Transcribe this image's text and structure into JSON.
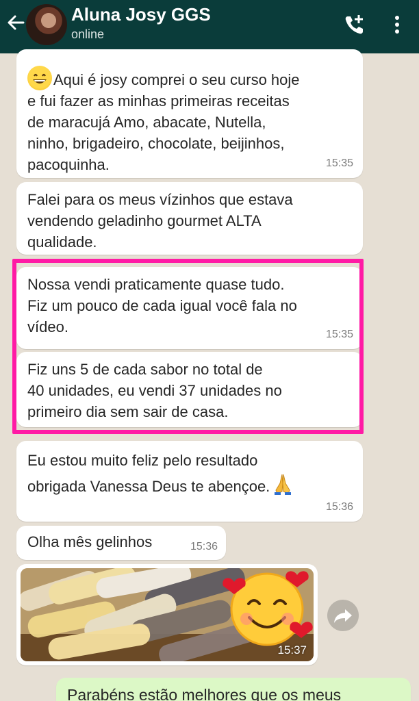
{
  "header": {
    "contact_name": "Aluna Josy GGS",
    "status": "online"
  },
  "messages": [
    {
      "text": "Aqui é josy comprei o seu curso hoje e fui fazer as minhas primeiras receitas de maracujá Amo, abacate, Nutella, ninho, brigadeiro, chocolate, beijinhos, pacoquinha.",
      "lines": [
        "Aqui é josy comprei o seu curso hoje",
        "e fui fazer as minhas primeiras receitas",
        "de maracujá Amo, abacate, Nutella,",
        "ninho, brigadeiro, chocolate, beijinhos,",
        "pacoquinha."
      ],
      "time": "15:35"
    },
    {
      "lines": [
        "Falei para os meus vízinhos que estava",
        "vendendo geladinho gourmet ALTA",
        "qualidade."
      ],
      "time": ""
    },
    {
      "lines": [
        "Nossa vendi praticamente quase tudo.",
        "Fiz um pouco de cada igual você fala no",
        "vídeo."
      ],
      "time": "15:35"
    },
    {
      "lines": [
        "Fiz uns 5 de cada sabor no total de",
        "40 unidades, eu vendi 37 unidades no",
        "primeiro dia sem sair de casa."
      ],
      "time": ""
    },
    {
      "lines": [
        "Eu estou muito feliz pelo resultado",
        "obrigada Vanessa Deus te abençoe."
      ],
      "time": "15:36"
    },
    {
      "lines": [
        "Olha mês gelinhos"
      ],
      "time": "15:36"
    },
    {
      "time": "15:37"
    },
    {
      "lines": [
        "Parabéns estão melhores que os meus"
      ]
    }
  ],
  "colors": {
    "header_bg": "#0a3c3a",
    "chat_bg": "#e6dfd4",
    "bubble_in": "#ffffff",
    "bubble_out": "#dcf8c6",
    "highlight": "#ff1aa5"
  },
  "icons": [
    "back-arrow-icon",
    "call-add-icon",
    "menu-icon",
    "share-icon"
  ]
}
